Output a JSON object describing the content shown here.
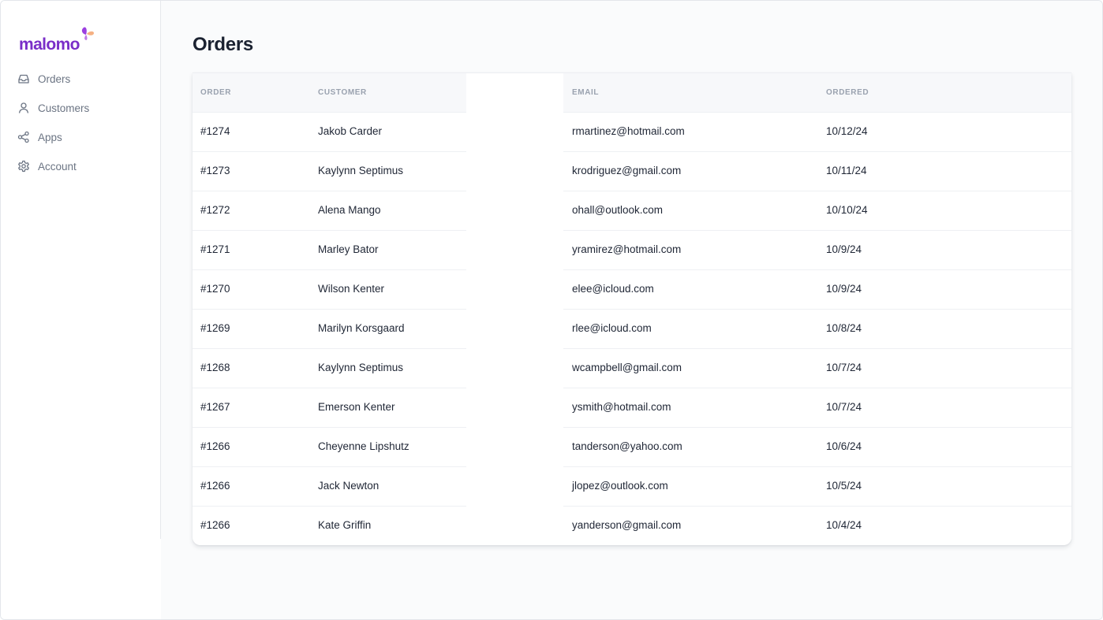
{
  "brand": {
    "name": "malomo",
    "accent": "#7a2ec8",
    "mark_colors": [
      "#9b3fe0",
      "#f5b183"
    ]
  },
  "sidebar": {
    "items": [
      {
        "label": "Orders",
        "icon": "inbox-icon"
      },
      {
        "label": "Customers",
        "icon": "user-icon"
      },
      {
        "label": "Apps",
        "icon": "share-icon"
      },
      {
        "label": "Account",
        "icon": "gear-icon"
      }
    ]
  },
  "page": {
    "title": "Orders"
  },
  "table": {
    "columns": [
      "ORDER",
      "CUSTOMER",
      "EMAIL",
      "ORDERED"
    ],
    "rows": [
      {
        "order": "#1274",
        "customer": "Jakob Carder",
        "email": "rmartinez@hotmail.com",
        "ordered": "10/12/24"
      },
      {
        "order": "#1273",
        "customer": "Kaylynn Septimus",
        "email": "krodriguez@gmail.com",
        "ordered": "10/11/24"
      },
      {
        "order": "#1272",
        "customer": "Alena Mango",
        "email": "ohall@outlook.com",
        "ordered": "10/10/24"
      },
      {
        "order": "#1271",
        "customer": "Marley Bator",
        "email": "yramirez@hotmail.com",
        "ordered": "10/9/24"
      },
      {
        "order": "#1270",
        "customer": "Wilson Kenter",
        "email": "elee@icloud.com",
        "ordered": "10/9/24"
      },
      {
        "order": "#1269",
        "customer": "Marilyn Korsgaard",
        "email": "rlee@icloud.com",
        "ordered": "10/8/24"
      },
      {
        "order": "#1268",
        "customer": "Kaylynn Septimus",
        "email": "wcampbell@gmail.com",
        "ordered": "10/7/24"
      },
      {
        "order": "#1267",
        "customer": "Emerson Kenter",
        "email": "ysmith@hotmail.com",
        "ordered": "10/7/24"
      },
      {
        "order": "#1266",
        "customer": "Cheyenne Lipshutz",
        "email": "tanderson@yahoo.com",
        "ordered": "10/6/24"
      },
      {
        "order": "#1266",
        "customer": "Jack Newton",
        "email": "jlopez@outlook.com",
        "ordered": "10/5/24"
      },
      {
        "order": "#1266",
        "customer": "Kate Griffin",
        "email": "yanderson@gmail.com",
        "ordered": "10/4/24"
      }
    ]
  }
}
